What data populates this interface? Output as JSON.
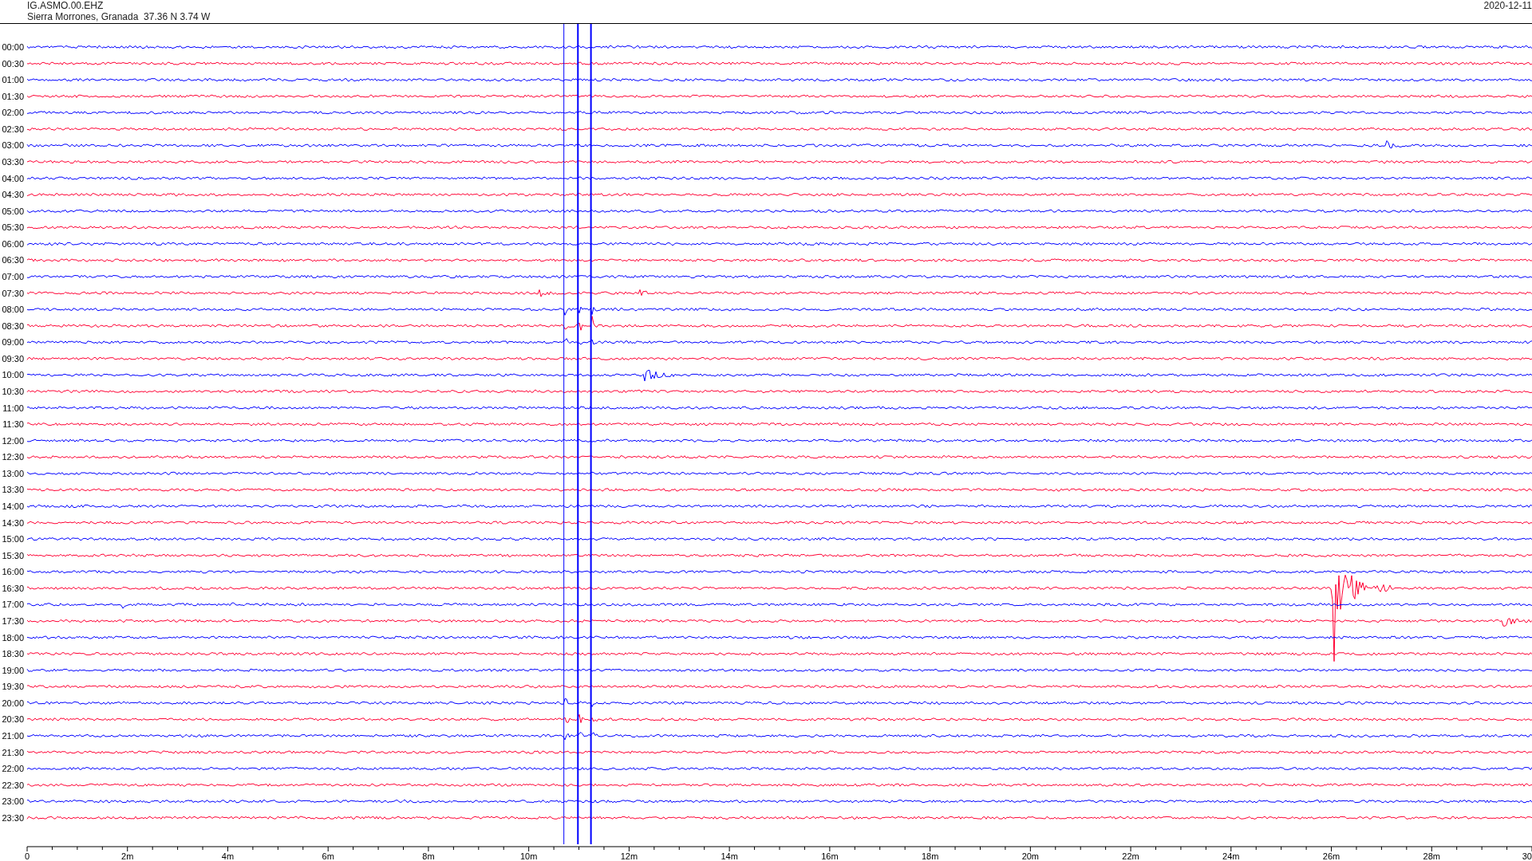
{
  "header": {
    "station": "IG.ASMO.00.EHZ",
    "location": "Sierra Morrones, Granada  37.36 N 3.74 W",
    "date": "2020-12-11"
  },
  "rows": [
    {
      "label": "00:00",
      "color": "#0000ff"
    },
    {
      "label": "00:30",
      "color": "#ff0033"
    },
    {
      "label": "01:00",
      "color": "#0000ff"
    },
    {
      "label": "01:30",
      "color": "#ff0033"
    },
    {
      "label": "02:00",
      "color": "#0000ff"
    },
    {
      "label": "02:30",
      "color": "#ff0033"
    },
    {
      "label": "03:00",
      "color": "#0000ff"
    },
    {
      "label": "03:30",
      "color": "#ff0033"
    },
    {
      "label": "04:00",
      "color": "#0000ff"
    },
    {
      "label": "04:30",
      "color": "#ff0033"
    },
    {
      "label": "05:00",
      "color": "#0000ff"
    },
    {
      "label": "05:30",
      "color": "#ff0033"
    },
    {
      "label": "06:00",
      "color": "#0000ff"
    },
    {
      "label": "06:30",
      "color": "#ff0033"
    },
    {
      "label": "07:00",
      "color": "#0000ff"
    },
    {
      "label": "07:30",
      "color": "#ff0033"
    },
    {
      "label": "08:00",
      "color": "#0000ff"
    },
    {
      "label": "08:30",
      "color": "#ff0033"
    },
    {
      "label": "09:00",
      "color": "#0000ff"
    },
    {
      "label": "09:30",
      "color": "#ff0033"
    },
    {
      "label": "10:00",
      "color": "#0000ff"
    },
    {
      "label": "10:30",
      "color": "#ff0033"
    },
    {
      "label": "11:00",
      "color": "#0000ff"
    },
    {
      "label": "11:30",
      "color": "#ff0033"
    },
    {
      "label": "12:00",
      "color": "#0000ff"
    },
    {
      "label": "12:30",
      "color": "#ff0033"
    },
    {
      "label": "13:00",
      "color": "#0000ff"
    },
    {
      "label": "13:30",
      "color": "#ff0033"
    },
    {
      "label": "14:00",
      "color": "#0000ff"
    },
    {
      "label": "14:30",
      "color": "#ff0033"
    },
    {
      "label": "15:00",
      "color": "#0000ff"
    },
    {
      "label": "15:30",
      "color": "#ff0033"
    },
    {
      "label": "16:00",
      "color": "#0000ff"
    },
    {
      "label": "16:30",
      "color": "#ff0033"
    },
    {
      "label": "17:00",
      "color": "#0000ff"
    },
    {
      "label": "17:30",
      "color": "#ff0033"
    },
    {
      "label": "18:00",
      "color": "#0000ff"
    },
    {
      "label": "18:30",
      "color": "#ff0033"
    },
    {
      "label": "19:00",
      "color": "#0000ff"
    },
    {
      "label": "19:30",
      "color": "#ff0033"
    },
    {
      "label": "20:00",
      "color": "#0000ff"
    },
    {
      "label": "20:30",
      "color": "#ff0033"
    },
    {
      "label": "21:00",
      "color": "#0000ff"
    },
    {
      "label": "21:30",
      "color": "#ff0033"
    },
    {
      "label": "22:00",
      "color": "#0000ff"
    },
    {
      "label": "22:30",
      "color": "#ff0033"
    },
    {
      "label": "23:00",
      "color": "#0000ff"
    },
    {
      "label": "23:30",
      "color": "#ff0033"
    }
  ],
  "x_axis": {
    "labels": [
      "0",
      "2m",
      "4m",
      "6m",
      "8m",
      "10m",
      "12m",
      "14m",
      "16m",
      "18m",
      "20m",
      "22m",
      "24m",
      "26m",
      "28m",
      "30"
    ]
  }
}
